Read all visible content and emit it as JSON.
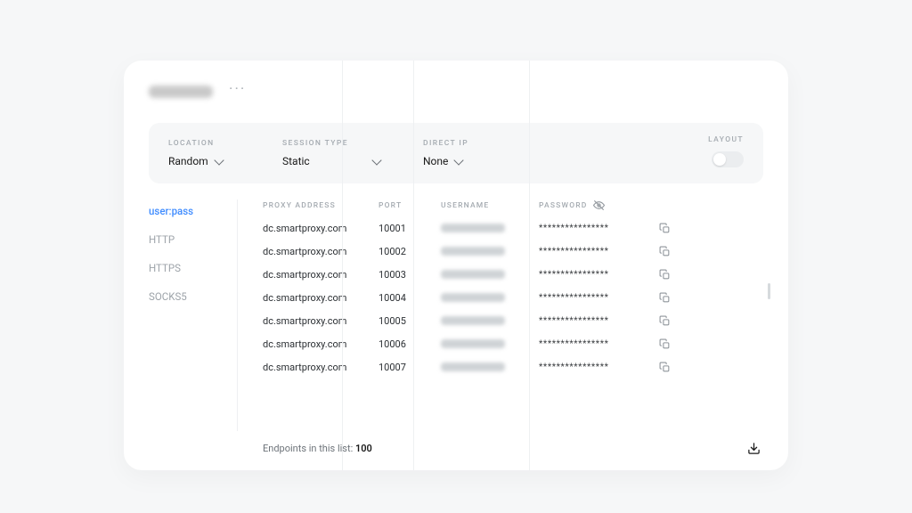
{
  "filters": {
    "location": {
      "label": "LOCATION",
      "value": "Random"
    },
    "session": {
      "label": "SESSION TYPE",
      "value": "Static"
    },
    "direct_ip": {
      "label": "DIRECT IP",
      "value": "None"
    },
    "layout": {
      "label": "LAYOUT"
    }
  },
  "tabs": {
    "userpass": "user:pass",
    "http": "HTTP",
    "https": "HTTPS",
    "socks5": "SOCKS5"
  },
  "table": {
    "headers": {
      "address": "PROXY ADDRESS",
      "port": "PORT",
      "user": "USERNAME",
      "pw": "PASSWORD"
    },
    "rows": [
      {
        "address": "dc.smartproxy.com",
        "port": "10001",
        "pw": "****************"
      },
      {
        "address": "dc.smartproxy.com",
        "port": "10002",
        "pw": "****************"
      },
      {
        "address": "dc.smartproxy.com",
        "port": "10003",
        "pw": "****************"
      },
      {
        "address": "dc.smartproxy.com",
        "port": "10004",
        "pw": "****************"
      },
      {
        "address": "dc.smartproxy.com",
        "port": "10005",
        "pw": "****************"
      },
      {
        "address": "dc.smartproxy.com",
        "port": "10006",
        "pw": "****************"
      },
      {
        "address": "dc.smartproxy.com",
        "port": "10007",
        "pw": "****************"
      }
    ]
  },
  "footer": {
    "label": "Endpoints in this list:",
    "count": "100"
  }
}
